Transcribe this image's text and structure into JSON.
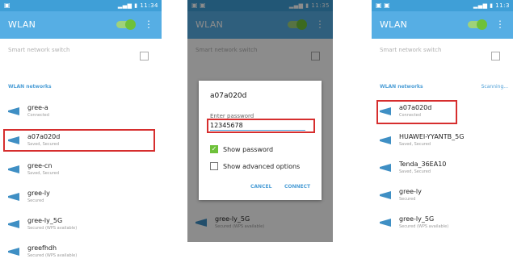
{
  "colors": {
    "status_bar": "#3f9fd7",
    "app_bar": "#56aee4",
    "accent": "#4c9ed6",
    "toggle_on": "#6ec13a",
    "highlight": "#d62e2e"
  },
  "screen1": {
    "status_time": "11:34",
    "title": "WLAN",
    "smart_title": "Smart network switch",
    "section": "WLAN networks",
    "networks": [
      {
        "name": "gree-a",
        "sub": "Connected"
      },
      {
        "name": "a07a020d",
        "sub": "Saved, Secured"
      },
      {
        "name": "gree-cn",
        "sub": "Saved, Secured"
      },
      {
        "name": "gree-ly",
        "sub": "Secured"
      },
      {
        "name": "gree-ly_5G",
        "sub": "Secured (WPS available)"
      },
      {
        "name": "greefhdh",
        "sub": "Secured (WPS available)"
      }
    ]
  },
  "screen2": {
    "status_time": "11:35",
    "title": "WLAN",
    "smart_title": "Smart network switch",
    "dialog": {
      "title": "a07a020d",
      "label": "Enter password",
      "password": "12345678",
      "show_password": "Show password",
      "advanced": "Show advanced options",
      "cancel": "CANCEL",
      "connect": "CONNECT"
    },
    "bottom_network": {
      "name": "gree-ly_5G",
      "sub": "Secured (WPS available)"
    }
  },
  "screen3": {
    "status_time": "11:3",
    "title": "WLAN",
    "smart_title": "Smart network switch",
    "section": "WLAN networks",
    "scanning": "Scanning...",
    "networks": [
      {
        "name": "a07a020d",
        "sub": "Connected"
      },
      {
        "name": "HUAWEI-YYANTB_5G",
        "sub": "Saved, Secured"
      },
      {
        "name": "Tenda_36EA10",
        "sub": "Saved, Secured"
      },
      {
        "name": "gree-ly",
        "sub": "Secured"
      },
      {
        "name": "gree-ly_5G",
        "sub": "Secured (WPS available)"
      }
    ]
  }
}
